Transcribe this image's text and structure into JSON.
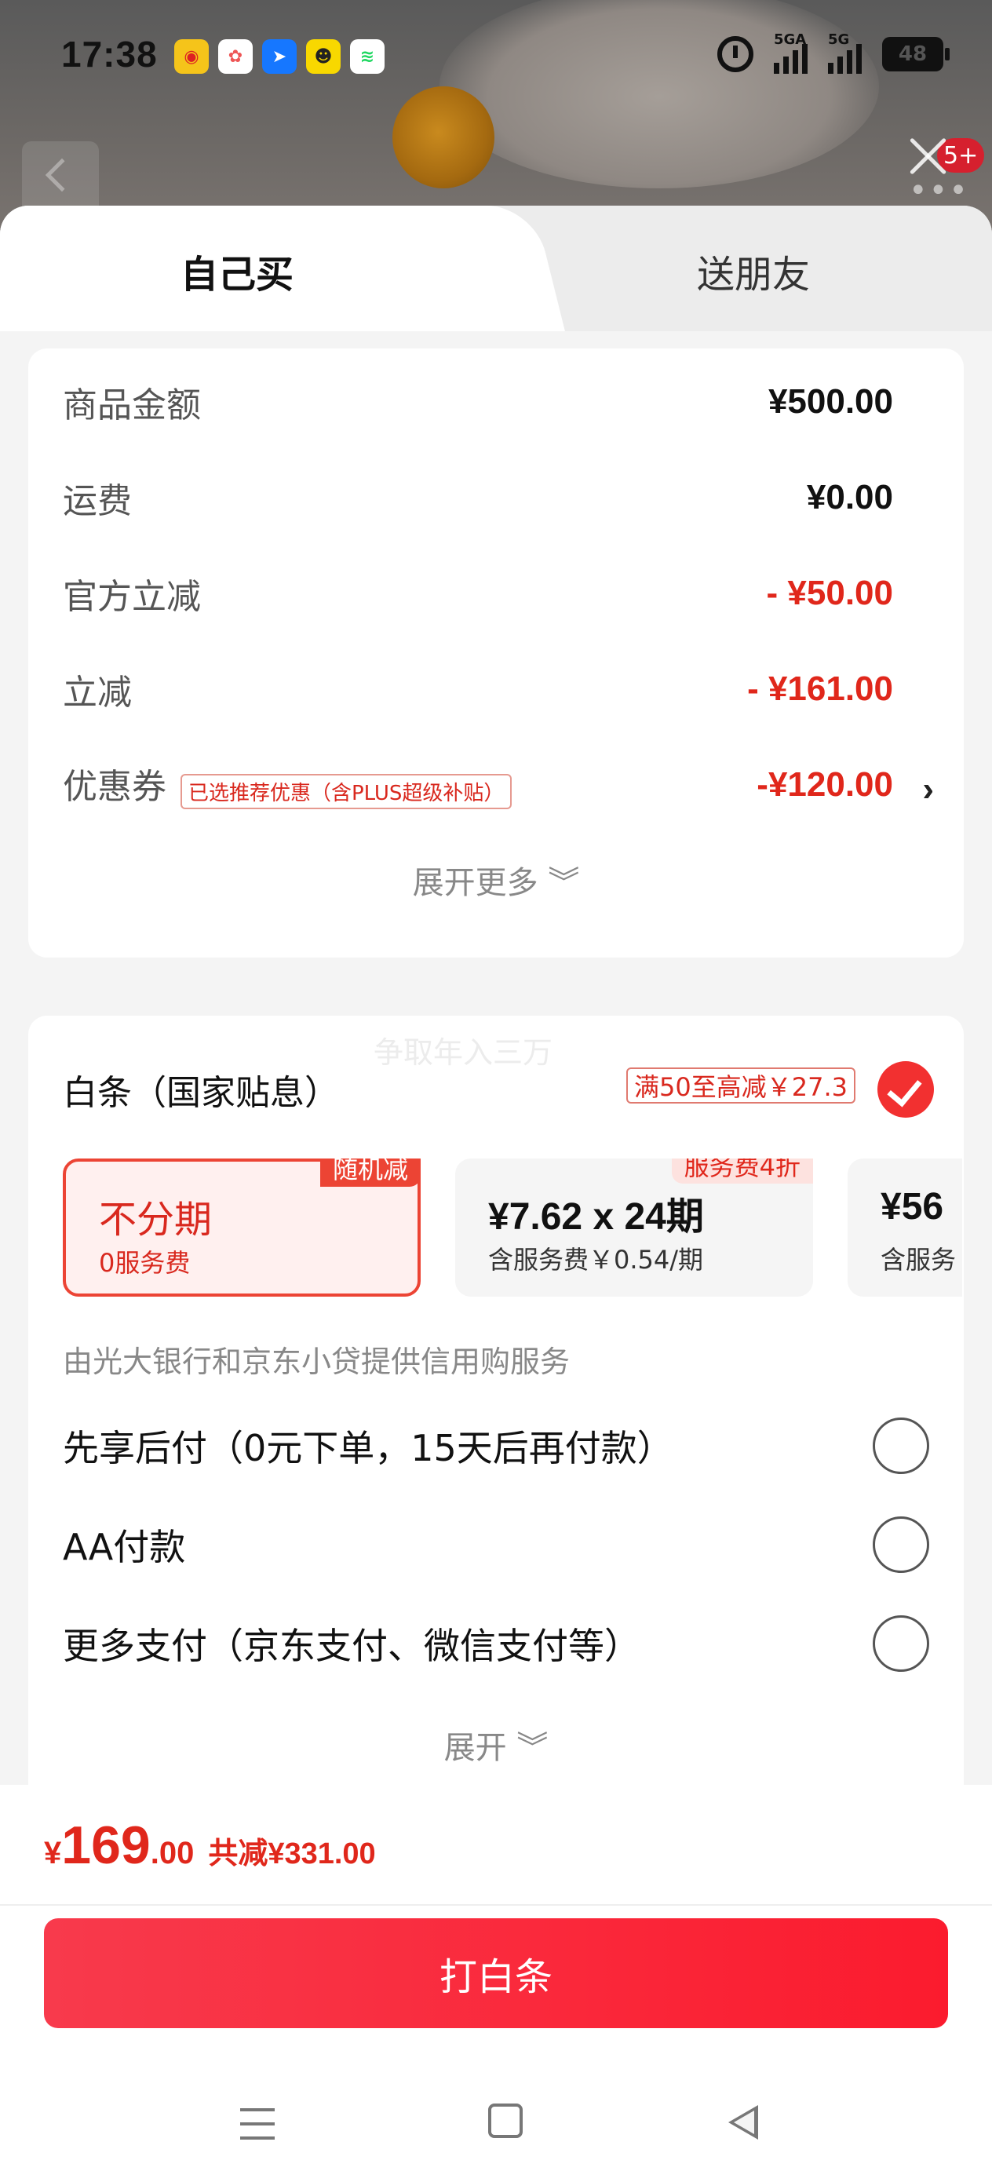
{
  "status_bar": {
    "time": "17:38",
    "apps": [
      {
        "icon": "weibo-icon",
        "color": "#f5c41a",
        "glyph": "◉"
      },
      {
        "icon": "photos-icon",
        "color": "#ffffff",
        "glyph": "✿"
      },
      {
        "icon": "alipay-icon",
        "color": "#1677ff",
        "glyph": "➤"
      },
      {
        "icon": "game-icon",
        "color": "#f8d800",
        "glyph": "☻"
      },
      {
        "icon": "spotify-icon",
        "color": "#1ed760",
        "glyph": "≋"
      }
    ],
    "signal1": "5GA",
    "signal2": "5G",
    "battery": "48"
  },
  "header": {
    "badge": "5+"
  },
  "tabs": {
    "self": "自己买",
    "friend": "送朋友"
  },
  "summary": {
    "rows": [
      {
        "label": "商品金额",
        "value": "¥500.00"
      },
      {
        "label": "运费",
        "value": "¥0.00"
      },
      {
        "label": "官方立减",
        "value": "- ¥50.00"
      },
      {
        "label": "立减",
        "value": "- ¥161.00"
      }
    ],
    "coupon": {
      "label": "优惠券",
      "tag": "已选推荐优惠（含PLUS超级补贴）",
      "value": "-¥120.00"
    },
    "expand_more": "展开更多 ︾"
  },
  "payment": {
    "watermark": "争取年入三万",
    "baitiao_title": "白条（国家贴息）",
    "promo": "满50至高减￥27.3",
    "plans": [
      {
        "main": "不分期",
        "sub": "0服务费",
        "tag": "随机减"
      },
      {
        "main": "¥7.62 x 24期",
        "sub": "含服务费￥0.54/期",
        "tag": "服务费4折"
      },
      {
        "main": "¥56",
        "sub": "含服务"
      }
    ],
    "provider": "由光大银行和京东小贷提供信用购服务",
    "options": [
      "先享后付（0元下单，15天后再付款）",
      "AA付款",
      "更多支付（京东支付、微信支付等）"
    ],
    "expand": "展开 ︾"
  },
  "footer": {
    "currency": "¥",
    "price_int": "169",
    "price_dec": ".00",
    "saved": "共减¥331.00",
    "pay_button": "打白条"
  },
  "colors": {
    "accent_red": "#e0271b",
    "button_red": "#fb1b2e"
  }
}
